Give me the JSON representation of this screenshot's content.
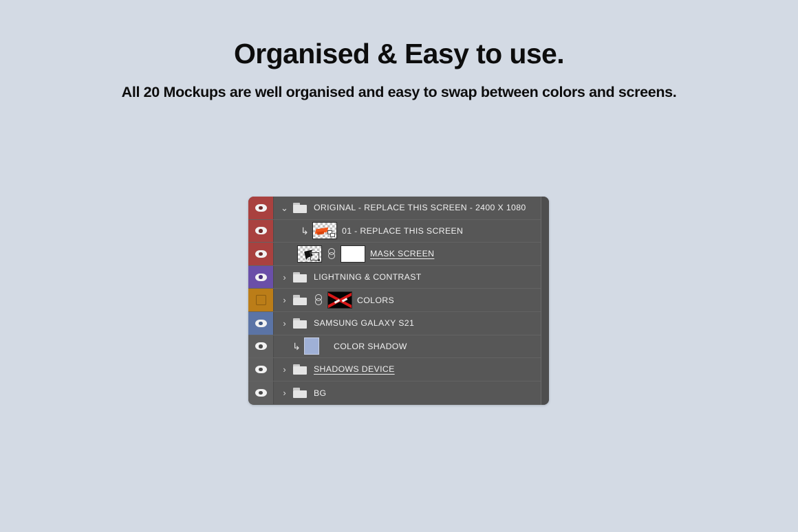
{
  "header": {
    "title": "Organised & Easy to use.",
    "subtitle": "All 20 Mockups are well organised and easy to swap between colors and screens."
  },
  "colors": {
    "page_background": "#d3dae4",
    "panel_background": "#575757",
    "row_separator": "#636363",
    "label_red": "#a9413f",
    "label_purple": "#6a4fa8",
    "label_orange": "#bb7d18",
    "label_blue": "#5b74a6",
    "label_gray": "#5f5f5f",
    "text": "#f0f0f0",
    "smart_object_orange": "#f2581c",
    "mask_disabled_x": "#d81818",
    "color_shadow_swatch": "#9fb0d6"
  },
  "layers_panel": {
    "rows": [
      {
        "name": "ORIGINAL - REPLACE THIS SCREEN - 2400 X 1080",
        "visible": true,
        "label_color": "red",
        "type": "group",
        "expanded": true,
        "underlined": false
      },
      {
        "name": "01 - REPLACE THIS SCREEN",
        "visible": true,
        "label_color": "red",
        "type": "smart-object",
        "clipped": true,
        "underlined": false
      },
      {
        "name": "MASK SCREEN",
        "visible": true,
        "label_color": "red",
        "type": "layer-with-mask",
        "linked": true,
        "underlined": true
      },
      {
        "name": "LIGHTNING & CONTRAST",
        "visible": true,
        "label_color": "purple",
        "type": "group",
        "expanded": false,
        "underlined": false
      },
      {
        "name": "COLORS",
        "visible": false,
        "label_color": "orange",
        "type": "group-with-disabled-mask",
        "expanded": false,
        "linked": true,
        "underlined": false
      },
      {
        "name": "SAMSUNG GALAXY S21",
        "visible": true,
        "label_color": "blue",
        "type": "group",
        "expanded": false,
        "underlined": false
      },
      {
        "name": "COLOR SHADOW",
        "visible": true,
        "label_color": "gray",
        "type": "solid-fill",
        "clipped": true,
        "underlined": false
      },
      {
        "name": "SHADOWS DEVICE",
        "visible": true,
        "label_color": "gray",
        "type": "group",
        "expanded": false,
        "underlined": true
      },
      {
        "name": "BG",
        "visible": true,
        "label_color": "gray",
        "type": "group",
        "expanded": false,
        "underlined": false
      }
    ],
    "icons": {
      "eye": "eye-icon",
      "eye_off": "eye-off-icon",
      "chevron_open": "chevron-down-icon",
      "chevron_closed": "chevron-right-icon",
      "clip": "clipping-mask-arrow-icon",
      "folder": "folder-icon",
      "link": "link-icon"
    },
    "glyphs": {
      "chevron_open": "⌄",
      "chevron_closed": "›",
      "clip": "↳"
    }
  }
}
